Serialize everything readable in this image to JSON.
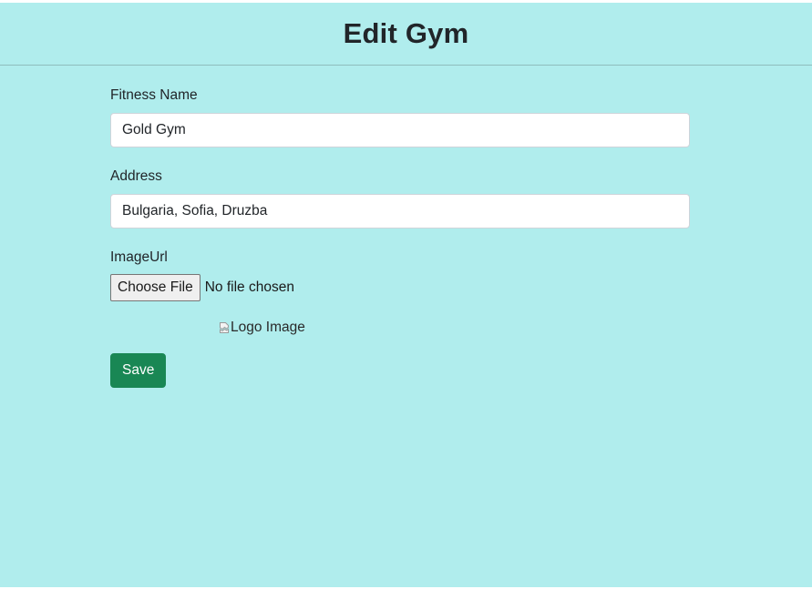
{
  "header": {
    "title": "Edit Gym"
  },
  "form": {
    "fitness_name": {
      "label": "Fitness Name",
      "value": "Gold Gym"
    },
    "address": {
      "label": "Address",
      "value": "Bulgaria, Sofia, Druzba"
    },
    "image_url": {
      "label": "ImageUrl",
      "button_label": "Choose File",
      "status": "No file chosen"
    },
    "logo_image": {
      "alt": "Logo Image",
      "icon": "broken-image-icon"
    },
    "save_label": "Save"
  },
  "colors": {
    "page_background": "#b0eded",
    "save_button": "#198754",
    "text": "#212529"
  }
}
